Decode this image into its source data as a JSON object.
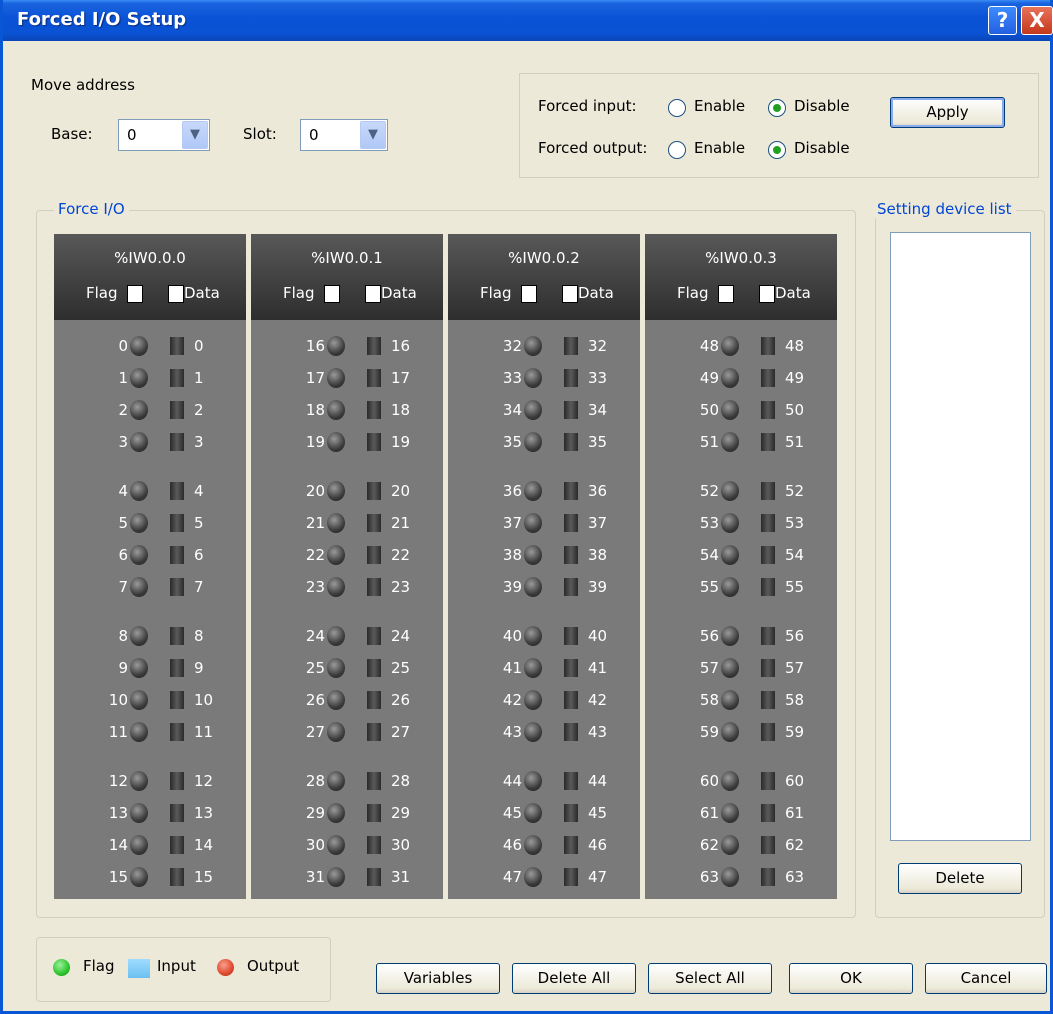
{
  "window": {
    "title": "Forced I/O Setup",
    "help_glyph": "?",
    "close_glyph": "X"
  },
  "move_address": {
    "heading": "Move address",
    "base_label": "Base:",
    "base_value": "0",
    "slot_label": "Slot:",
    "slot_value": "0"
  },
  "forced": {
    "input_label": "Forced input:",
    "output_label": "Forced output:",
    "enable_label": "Enable",
    "disable_label": "Disable",
    "input_selected": "Disable",
    "output_selected": "Disable",
    "apply_label": "Apply"
  },
  "force_io": {
    "group_title": "Force I/O",
    "flag_label": "Flag",
    "data_label": "Data",
    "columns": [
      {
        "address": "%IW0.0.0",
        "start": 0
      },
      {
        "address": "%IW0.0.1",
        "start": 16
      },
      {
        "address": "%IW0.0.2",
        "start": 32
      },
      {
        "address": "%IW0.0.3",
        "start": 48
      }
    ]
  },
  "device_list": {
    "title": "Setting device list",
    "delete_label": "Delete"
  },
  "legend": {
    "flag": "Flag",
    "input": "Input",
    "output": "Output"
  },
  "colors": {
    "flag": "#2cc42c",
    "input": "#6cc0f0",
    "output": "#e0482c",
    "title_blue": "#0046d5"
  },
  "buttons": {
    "variables": "Variables",
    "delete_all": "Delete All",
    "select_all": "Select All",
    "ok": "OK",
    "cancel": "Cancel"
  }
}
